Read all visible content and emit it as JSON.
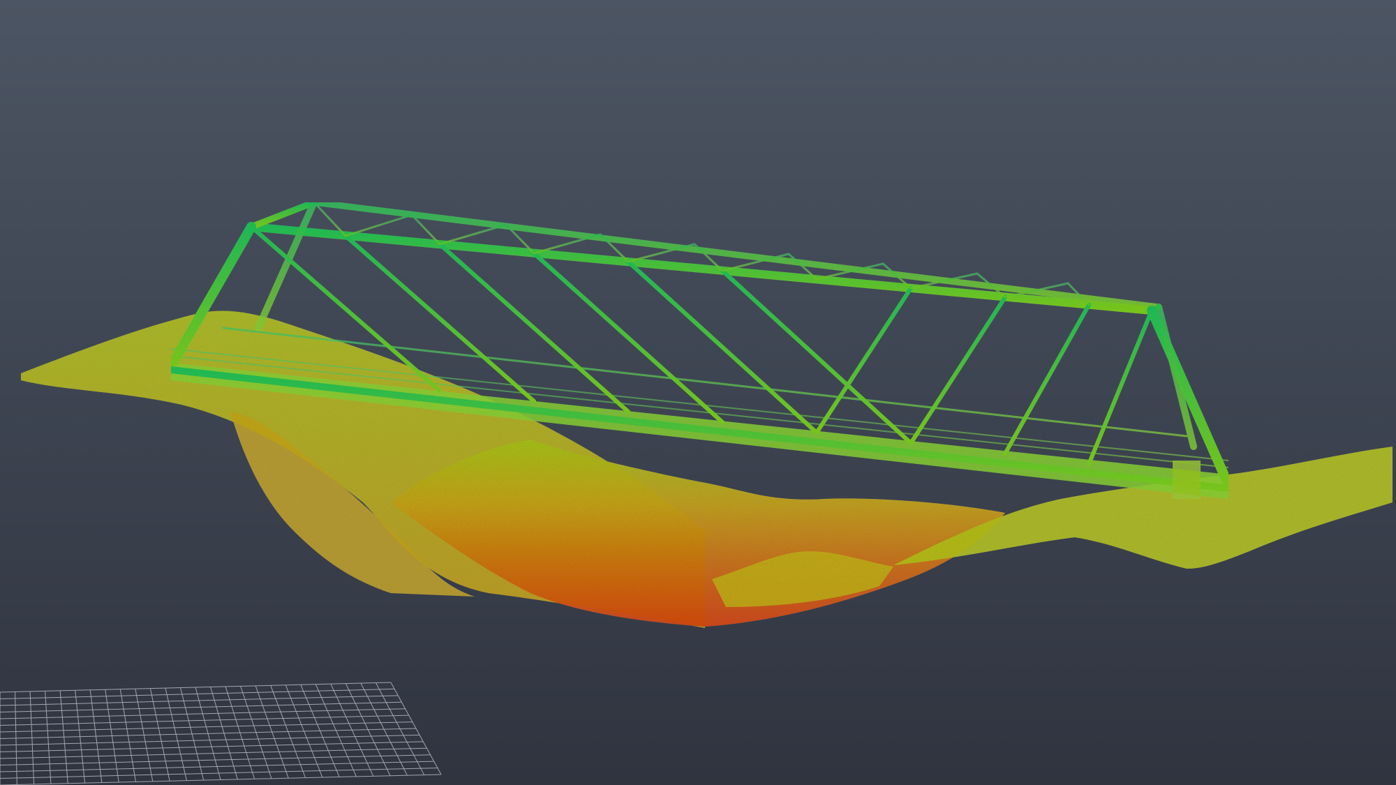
{
  "scene": {
    "type": "point-cloud-viewport",
    "subject": "bridge-and-riverbed",
    "color_ramp": [
      "#d9470c",
      "#c9a514",
      "#a8c61a",
      "#5fcc22",
      "#1ec75a"
    ],
    "background_top": "#4c5563",
    "background_bottom": "#2f343f",
    "ground_grid_color": "#c7ccd4"
  }
}
